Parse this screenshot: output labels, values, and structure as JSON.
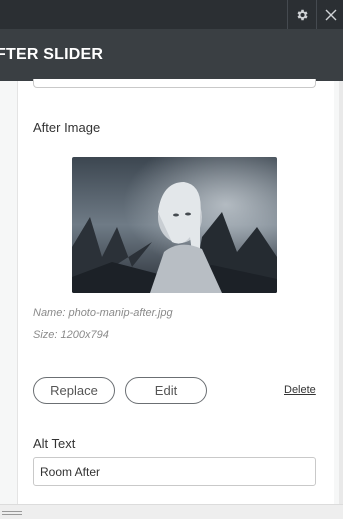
{
  "header": {
    "title": "FTER SLIDER",
    "settings_icon": "gear-icon",
    "close_icon": "close-icon"
  },
  "after_image": {
    "label": "After Image",
    "name_meta": "Name: photo-manip-after.jpg",
    "size_meta": "Size: 1200x794",
    "replace_label": "Replace",
    "edit_label": "Edit",
    "delete_label": "Delete"
  },
  "alt_text": {
    "label": "Alt Text",
    "value": "Room After"
  },
  "colors": {
    "topbar": "#2b2f33",
    "title_bar": "#3a3f43",
    "panel_bg": "#f6f7f7"
  }
}
